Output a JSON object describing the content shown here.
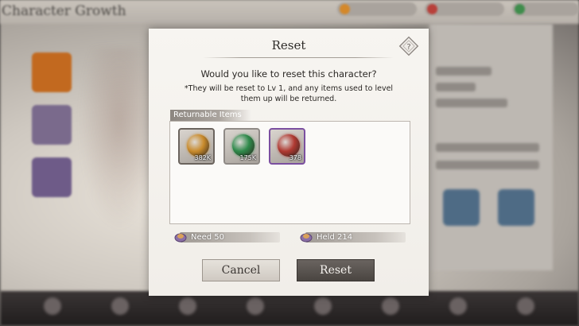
{
  "background": {
    "screen_title": "Character Growth"
  },
  "dialog": {
    "title": "Reset",
    "help_icon": "question-diamond-icon",
    "question": "Would you like to reset this character?",
    "note": "*They will be reset to Lv 1, and any items used to level them up will be returned.",
    "returnable_label": "Returnable Items",
    "items": [
      {
        "name": "gold-orb",
        "count": "382K",
        "color": "#c98b2c",
        "frame": "#6b645e"
      },
      {
        "name": "green-orb",
        "count": "175K",
        "color": "#2f8a4b",
        "frame": "#8f8a86"
      },
      {
        "name": "red-orb",
        "count": "378",
        "color": "#b03a32",
        "frame": "#7b4fa0"
      }
    ],
    "need_label": "Need 50",
    "held_label": "Held  214",
    "cancel_label": "Cancel",
    "reset_label": "Reset"
  }
}
